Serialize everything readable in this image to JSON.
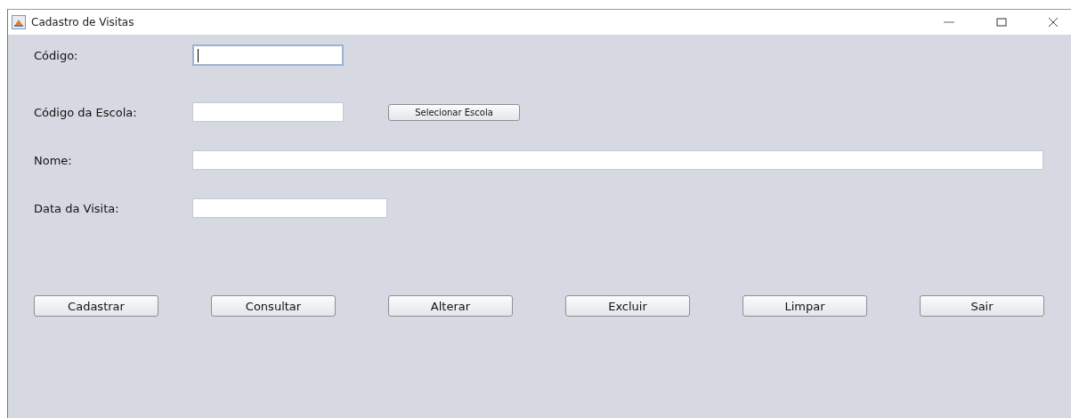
{
  "window": {
    "title": "Cadastro de Visitas"
  },
  "fields": [
    {
      "label": "Código:",
      "kind": "short",
      "focused": true
    },
    {
      "label": "Código da Escola:",
      "kind": "short",
      "focused": false,
      "button": "Selecionar Escola"
    },
    {
      "label": "Nome:",
      "kind": "wide",
      "focused": false
    },
    {
      "label": "Data da Visita:",
      "kind": "medium",
      "focused": false
    }
  ],
  "buttons": [
    "Cadastrar",
    "Consultar",
    "Alterar",
    "Excluir",
    "Limpar",
    "Sair"
  ]
}
